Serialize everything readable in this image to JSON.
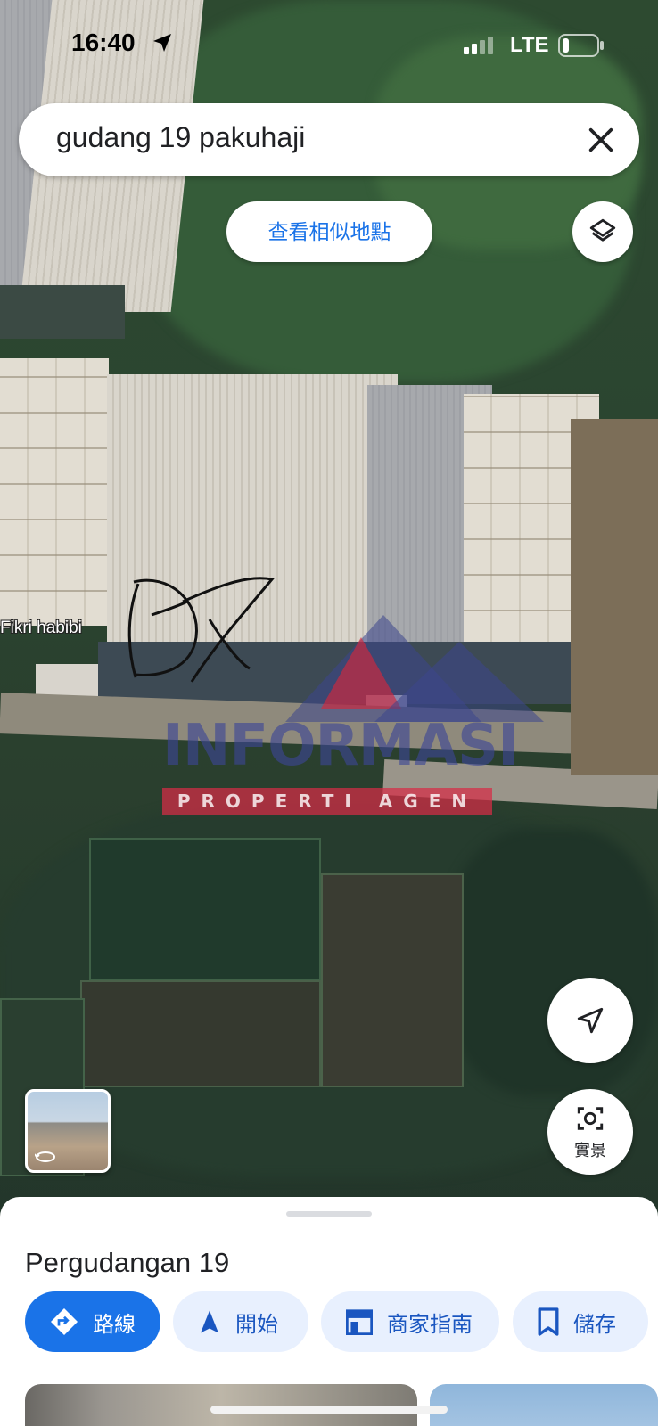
{
  "status_bar": {
    "time": "16:40",
    "network": "LTE",
    "icons": [
      "location-arrow-icon",
      "signal-icon",
      "battery-icon"
    ]
  },
  "search": {
    "query": "gudang 19 pakuhaji",
    "clear_icon": "close-icon"
  },
  "map": {
    "similar_places_label": "查看相似地點",
    "layers_icon": "layers-icon",
    "user_label": "Fikri habibi",
    "watermark": {
      "title": "INFORMASI",
      "subtitle": "PROPERTI AGEN"
    },
    "my_location_icon": "navigation-arrow-icon",
    "live_view_label": "實景",
    "live_view_icon": "camera-scan-icon",
    "street_view_icon": "rotate-360-icon"
  },
  "place": {
    "title": "Pergudangan 19",
    "actions": [
      {
        "label": "路線",
        "icon": "directions-icon"
      },
      {
        "label": "開始",
        "icon": "navigation-icon"
      },
      {
        "label": "商家指南",
        "icon": "storefront-icon"
      },
      {
        "label": "儲存",
        "icon": "bookmark-icon"
      }
    ]
  },
  "colors": {
    "accent": "#1a73e8",
    "chip_background": "#e8f0fe",
    "text_primary": "#202124"
  }
}
